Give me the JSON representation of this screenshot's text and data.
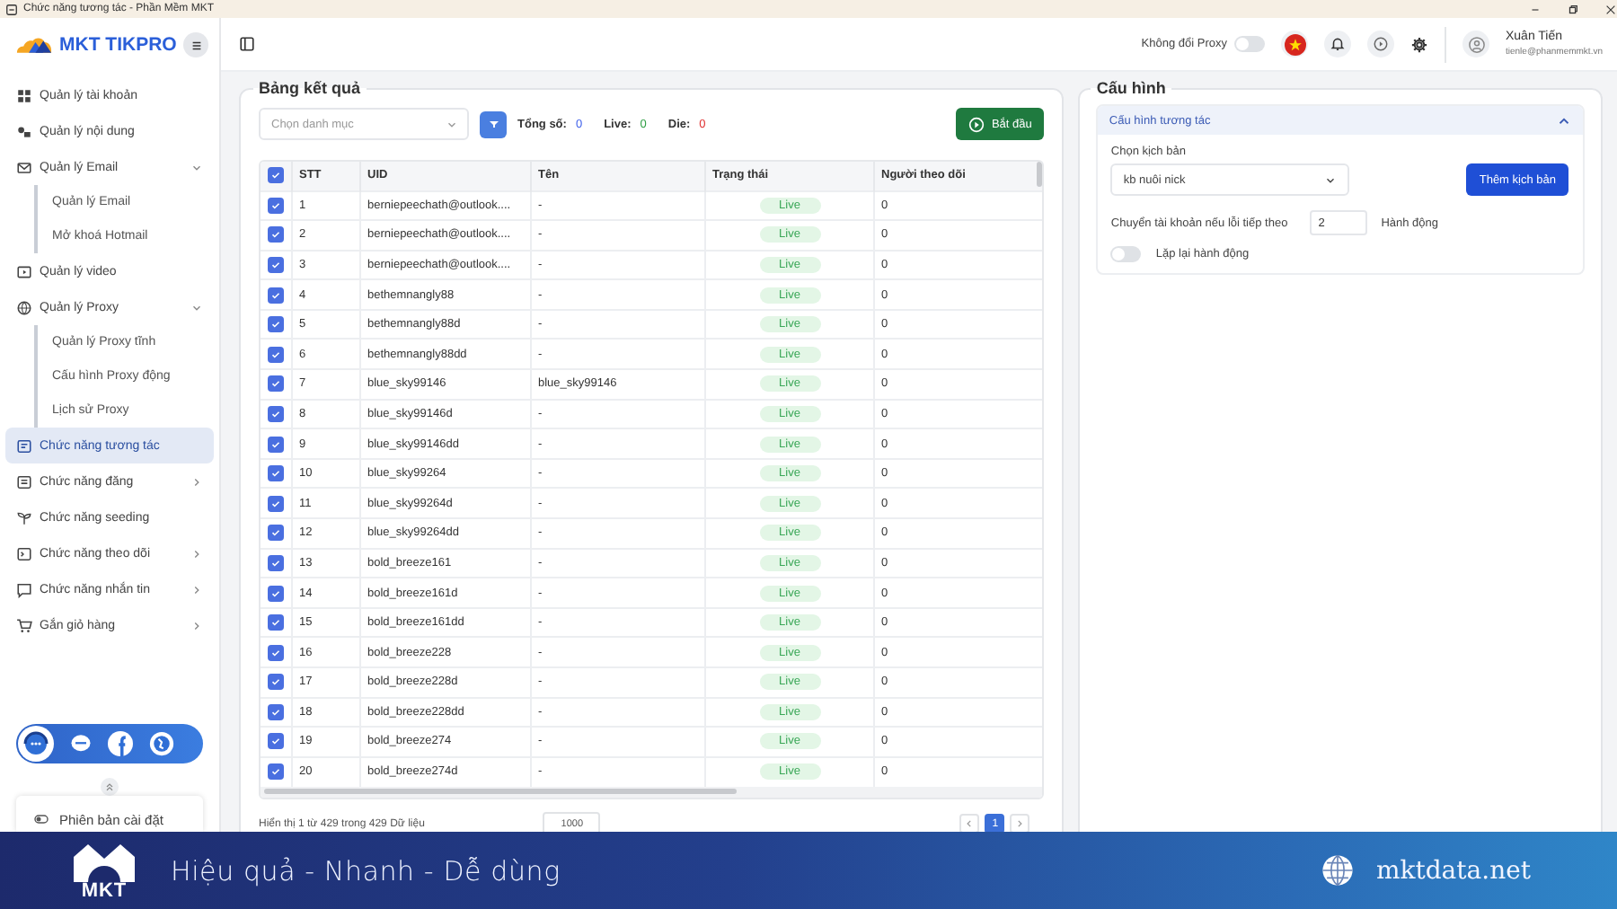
{
  "window": {
    "title": "Chức năng tương tác - Phần Mềm MKT"
  },
  "sidebar": {
    "logo": "MKT TIKPRO",
    "items": [
      {
        "kind": "item",
        "label": "Quản lý tài khoản",
        "selected": false
      },
      {
        "kind": "item",
        "label": "Quản lý nội dung",
        "selected": false
      },
      {
        "kind": "group",
        "label": "Quản lý Email",
        "selected": false,
        "expanded": true,
        "children": [
          {
            "label": "Quản lý Email",
            "selected": false
          },
          {
            "label": "Mở khoá Hotmail",
            "selected": false
          }
        ]
      },
      {
        "kind": "item",
        "label": "Quản lý video",
        "selected": false
      },
      {
        "kind": "group",
        "label": "Quản lý Proxy",
        "selected": false,
        "expanded": true,
        "children": [
          {
            "label": "Quản lý Proxy tĩnh",
            "selected": false
          },
          {
            "label": "Cấu hình Proxy động",
            "selected": false
          },
          {
            "label": "Lịch sử Proxy",
            "selected": false
          }
        ]
      },
      {
        "kind": "item",
        "label": "Chức năng tương tác",
        "selected": true
      },
      {
        "kind": "group",
        "label": "Chức năng đăng",
        "selected": false,
        "expanded": false
      },
      {
        "kind": "item",
        "label": "Chức năng seeding",
        "selected": false
      },
      {
        "kind": "group",
        "label": "Chức năng theo dõi",
        "selected": false,
        "expanded": false
      },
      {
        "kind": "group",
        "label": "Chức năng nhắn tin",
        "selected": false,
        "expanded": false
      },
      {
        "kind": "group",
        "label": "Gắn giỏ hàng",
        "selected": false,
        "expanded": false
      }
    ],
    "version_label": "Phiên bản cài đặt"
  },
  "header": {
    "proxy_toggle": {
      "label": "Không đổi Proxy",
      "on": false
    },
    "user": {
      "name": "Xuân Tiến",
      "email": "tienle@phanmemmkt.vn"
    }
  },
  "results": {
    "title": "Bảng kết quả",
    "category": {
      "placeholder": "Chọn danh mục"
    },
    "stats": [
      {
        "label": "Tổng số:",
        "value": "0",
        "color": "#4263eb"
      },
      {
        "label": "Live:",
        "value": "0",
        "color": "#2f9e44"
      },
      {
        "label": "Die:",
        "value": "0",
        "color": "#e03131"
      }
    ],
    "start_button": "Bắt đầu",
    "table": {
      "all_checked": true,
      "columns": [
        "STT",
        "UID",
        "Tên",
        "Trạng thái",
        "Người theo dõi"
      ],
      "rows": [
        {
          "checked": true,
          "stt": "1",
          "uid": "berniepeechath@outlook....",
          "name": "-",
          "status": "Live",
          "followers": "0"
        },
        {
          "checked": true,
          "stt": "2",
          "uid": "berniepeechath@outlook....",
          "name": "-",
          "status": "Live",
          "followers": "0"
        },
        {
          "checked": true,
          "stt": "3",
          "uid": "berniepeechath@outlook....",
          "name": "-",
          "status": "Live",
          "followers": "0"
        },
        {
          "checked": true,
          "stt": "4",
          "uid": "bethemnangly88",
          "name": "-",
          "status": "Live",
          "followers": "0"
        },
        {
          "checked": true,
          "stt": "5",
          "uid": "bethemnangly88d",
          "name": "-",
          "status": "Live",
          "followers": "0"
        },
        {
          "checked": true,
          "stt": "6",
          "uid": "bethemnangly88dd",
          "name": "-",
          "status": "Live",
          "followers": "0"
        },
        {
          "checked": true,
          "stt": "7",
          "uid": "blue_sky99146",
          "name": "blue_sky99146",
          "status": "Live",
          "followers": "0"
        },
        {
          "checked": true,
          "stt": "8",
          "uid": "blue_sky99146d",
          "name": "-",
          "status": "Live",
          "followers": "0"
        },
        {
          "checked": true,
          "stt": "9",
          "uid": "blue_sky99146dd",
          "name": "-",
          "status": "Live",
          "followers": "0"
        },
        {
          "checked": true,
          "stt": "10",
          "uid": "blue_sky99264",
          "name": "-",
          "status": "Live",
          "followers": "0"
        },
        {
          "checked": true,
          "stt": "11",
          "uid": "blue_sky99264d",
          "name": "-",
          "status": "Live",
          "followers": "0"
        },
        {
          "checked": true,
          "stt": "12",
          "uid": "blue_sky99264dd",
          "name": "-",
          "status": "Live",
          "followers": "0"
        },
        {
          "checked": true,
          "stt": "13",
          "uid": "bold_breeze161",
          "name": "-",
          "status": "Live",
          "followers": "0"
        },
        {
          "checked": true,
          "stt": "14",
          "uid": "bold_breeze161d",
          "name": "-",
          "status": "Live",
          "followers": "0"
        },
        {
          "checked": true,
          "stt": "15",
          "uid": "bold_breeze161dd",
          "name": "-",
          "status": "Live",
          "followers": "0"
        },
        {
          "checked": true,
          "stt": "16",
          "uid": "bold_breeze228",
          "name": "-",
          "status": "Live",
          "followers": "0"
        },
        {
          "checked": true,
          "stt": "17",
          "uid": "bold_breeze228d",
          "name": "-",
          "status": "Live",
          "followers": "0"
        },
        {
          "checked": true,
          "stt": "18",
          "uid": "bold_breeze228dd",
          "name": "-",
          "status": "Live",
          "followers": "0"
        },
        {
          "checked": true,
          "stt": "19",
          "uid": "bold_breeze274",
          "name": "-",
          "status": "Live",
          "followers": "0"
        },
        {
          "checked": true,
          "stt": "20",
          "uid": "bold_breeze274d",
          "name": "-",
          "status": "Live",
          "followers": "0"
        }
      ]
    },
    "footer": {
      "summary": "Hiển thị 1 từ 429 trong 429 Dữ liệu",
      "page_size": "1000",
      "pages": [
        {
          "label": "1",
          "selected": true
        }
      ]
    }
  },
  "config": {
    "title": "Cấu hình",
    "section": {
      "title": "Cấu hình tương tác",
      "expanded": true
    },
    "script_label": "Chọn kịch bản",
    "script_value": "kb nuôi nick",
    "add_button": "Thêm kịch bản",
    "retry_label": "Chuyển tài khoản nếu lỗi tiếp theo",
    "retry_value": "2",
    "retry_unit": "Hành động",
    "repeat": {
      "label": "Lặp lại hành động",
      "on": false
    }
  },
  "banner": {
    "logo": "MKT",
    "slogan": "Hiệu quả - Nhanh - Dễ dùng",
    "website": "mktdata.net"
  }
}
